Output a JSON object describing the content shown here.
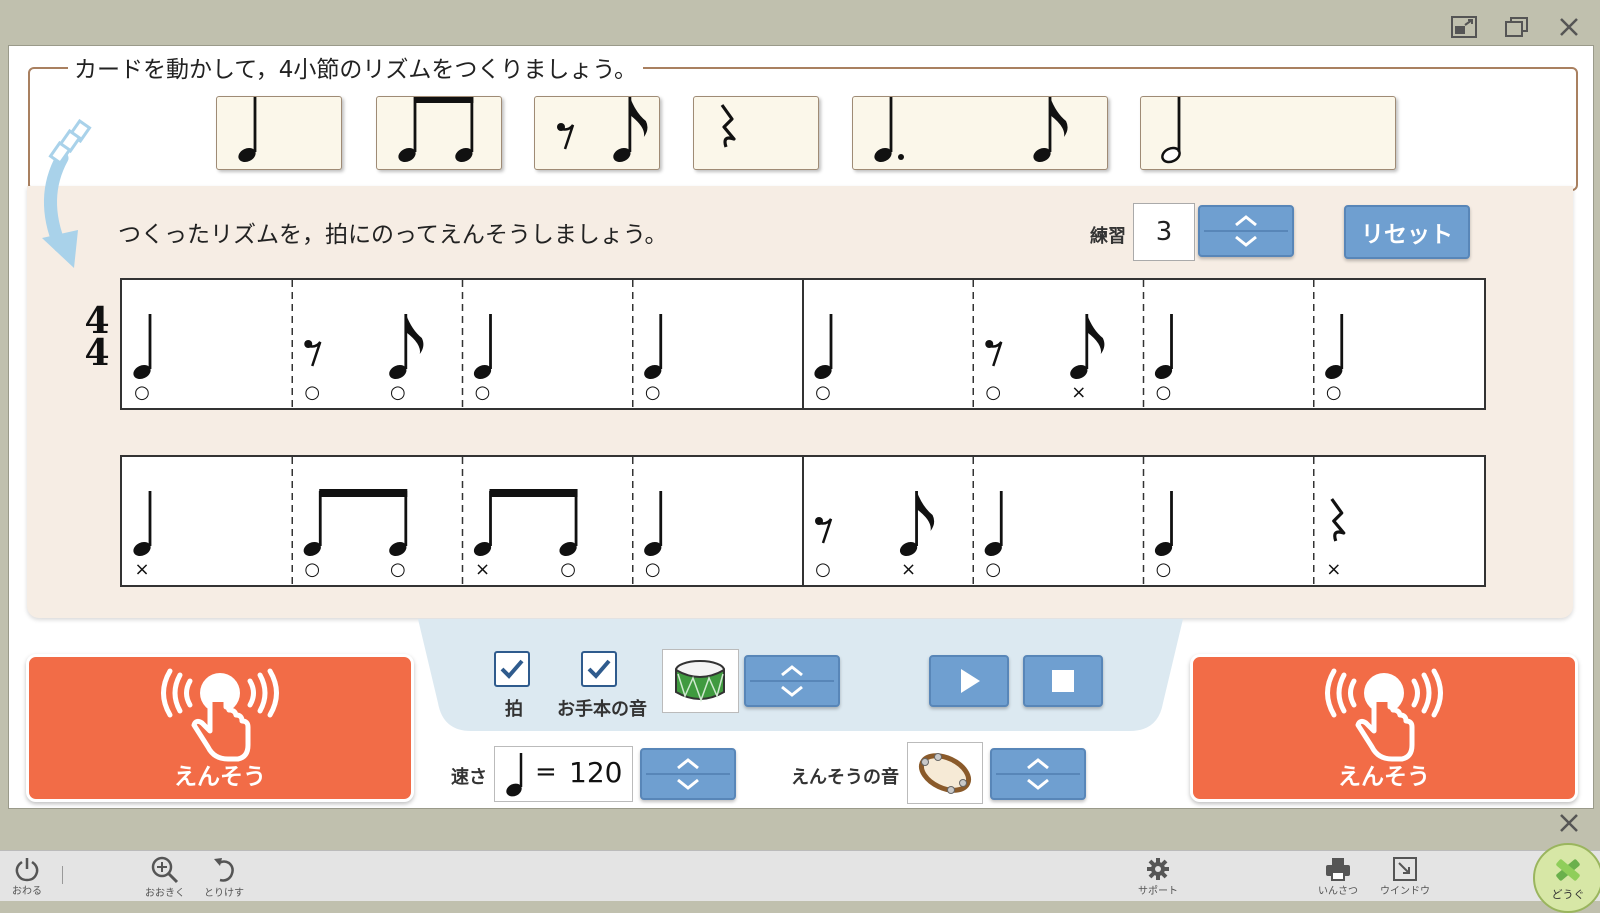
{
  "window": {
    "controls": [
      "fullscreen-icon",
      "restore-icon",
      "close-icon"
    ]
  },
  "card_tray": {
    "instruction": "カードを動かして，4小節のリズムをつくりましょう。",
    "cards": [
      {
        "rhythm": "quarter"
      },
      {
        "rhythm": "two-eighths"
      },
      {
        "rhythm": "eighth-rest-eighth"
      },
      {
        "rhythm": "quarter-rest"
      },
      {
        "rhythm": "dotted-quarter-eighth"
      },
      {
        "rhythm": "half"
      }
    ]
  },
  "score_area": {
    "instruction": "つくったリズムを，拍にのってえんそうしましょう。",
    "practice_label": "練習",
    "practice_number": "3",
    "reset_label": "リセット",
    "time_signature": {
      "top": "4",
      "bottom": "4"
    },
    "rows": [
      {
        "beats": [
          {
            "rhythm": "quarter",
            "marks": [
              "○"
            ]
          },
          {
            "rhythm": "eighth-rest-eighth",
            "marks": [
              "○",
              "○"
            ]
          },
          {
            "rhythm": "quarter",
            "marks": [
              "○"
            ]
          },
          {
            "rhythm": "quarter",
            "marks": [
              "○"
            ]
          },
          {
            "rhythm": "quarter",
            "marks": [
              "○"
            ]
          },
          {
            "rhythm": "eighth-rest-eighth",
            "marks": [
              "○",
              "×"
            ]
          },
          {
            "rhythm": "quarter",
            "marks": [
              "○"
            ]
          },
          {
            "rhythm": "quarter",
            "marks": [
              "○"
            ]
          }
        ]
      },
      {
        "beats": [
          {
            "rhythm": "quarter",
            "marks": [
              "×"
            ]
          },
          {
            "rhythm": "two-eighths",
            "marks": [
              "○",
              "○"
            ]
          },
          {
            "rhythm": "two-eighths",
            "marks": [
              "×",
              "○"
            ]
          },
          {
            "rhythm": "quarter",
            "marks": [
              "○"
            ]
          },
          {
            "rhythm": "eighth-rest-eighth",
            "marks": [
              "○",
              "×"
            ]
          },
          {
            "rhythm": "quarter",
            "marks": [
              "○"
            ]
          },
          {
            "rhythm": "quarter",
            "marks": [
              "○"
            ]
          },
          {
            "rhythm": "quarter-rest",
            "marks": [
              "×"
            ]
          }
        ]
      }
    ]
  },
  "controls": {
    "beat_label": "拍",
    "beat_checked": true,
    "model_sound_label": "お手本の音",
    "model_sound_checked": true,
    "model_instrument_icon": "drum-icon",
    "tempo_label": "速さ",
    "tempo_equals": "=",
    "tempo_value": "120",
    "perform_sound_label": "えんそうの音",
    "perform_instrument_icon": "tambourine-icon",
    "perform_left_label": "えんそう",
    "perform_right_label": "えんそう",
    "accent_color": "#f26c47",
    "button_color": "#6f9fd0"
  },
  "toolbar": {
    "items": [
      {
        "icon": "power-icon",
        "label": "おわる"
      },
      {
        "icon": "zoom-in-icon",
        "label": "おおきく"
      },
      {
        "icon": "undo-icon",
        "label": "とりけす"
      },
      {
        "icon": "gear-icon",
        "label": "サポート"
      },
      {
        "icon": "print-icon",
        "label": "いんさつ"
      },
      {
        "icon": "window-icon",
        "label": "ウインドウ"
      },
      {
        "icon": "tools-icon",
        "label": "どうぐ"
      }
    ]
  }
}
